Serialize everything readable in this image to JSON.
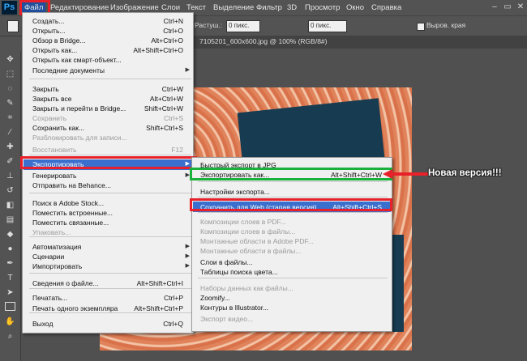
{
  "app": {
    "logo": "Ps"
  },
  "menubar": [
    "Файл",
    "Редактирование",
    "Изображение",
    "Слои",
    "Текст",
    "Выделение",
    "Фильтр",
    "3D",
    "Просмотр",
    "Окно",
    "Справка"
  ],
  "options": {
    "feather_label": "Растуш.:",
    "feather_value": "0 пикс.",
    "width_value": "0 пикс.",
    "antialias_label": "Выров. края"
  },
  "document_tab": {
    "title": "7105201_600x600.jpg @ 100% (RGB/8#)"
  },
  "file_menu": {
    "items": [
      {
        "label": "Создать...",
        "shortcut": "Ctrl+N",
        "disabled": false
      },
      {
        "label": "Открыть...",
        "shortcut": "Ctrl+O",
        "disabled": false
      },
      {
        "label": "Обзор в Bridge...",
        "shortcut": "Alt+Ctrl+O",
        "disabled": false
      },
      {
        "label": "Открыть как...",
        "shortcut": "Alt+Shift+Ctrl+O",
        "disabled": false
      },
      {
        "label": "Открыть как смарт-объект...",
        "shortcut": "",
        "disabled": false
      },
      {
        "label": "Последние документы",
        "shortcut": "",
        "disabled": false
      },
      {
        "label": "Закрыть",
        "shortcut": "Ctrl+W",
        "disabled": false
      },
      {
        "label": "Закрыть все",
        "shortcut": "Alt+Ctrl+W",
        "disabled": false
      },
      {
        "label": "Закрыть и перейти в Bridge...",
        "shortcut": "Shift+Ctrl+W",
        "disabled": false
      },
      {
        "label": "Сохранить",
        "shortcut": "Ctrl+S",
        "disabled": true
      },
      {
        "label": "Сохранить как...",
        "shortcut": "Shift+Ctrl+S",
        "disabled": false
      },
      {
        "label": "Разблокировать для записи...",
        "shortcut": "",
        "disabled": true
      },
      {
        "label": "Восстановить",
        "shortcut": "F12",
        "disabled": true
      },
      {
        "label": "Экспортировать",
        "shortcut": "",
        "disabled": false
      },
      {
        "label": "Генерировать",
        "shortcut": "",
        "disabled": false
      },
      {
        "label": "Отправить на Behance...",
        "shortcut": "",
        "disabled": false
      },
      {
        "label": "Поиск в Adobe Stock...",
        "shortcut": "",
        "disabled": false
      },
      {
        "label": "Поместить встроенные...",
        "shortcut": "",
        "disabled": false
      },
      {
        "label": "Поместить связанные...",
        "shortcut": "",
        "disabled": false
      },
      {
        "label": "Упаковать...",
        "shortcut": "",
        "disabled": true
      },
      {
        "label": "Автоматизация",
        "shortcut": "",
        "disabled": false
      },
      {
        "label": "Сценарии",
        "shortcut": "",
        "disabled": false
      },
      {
        "label": "Импортировать",
        "shortcut": "",
        "disabled": false
      },
      {
        "label": "Сведения о файле...",
        "shortcut": "Alt+Shift+Ctrl+I",
        "disabled": false
      },
      {
        "label": "Печатать...",
        "shortcut": "Ctrl+P",
        "disabled": false
      },
      {
        "label": "Печать одного экземпляра",
        "shortcut": "Alt+Shift+Ctrl+P",
        "disabled": false
      },
      {
        "label": "Выход",
        "shortcut": "Ctrl+Q",
        "disabled": false
      }
    ]
  },
  "export_menu": {
    "items": [
      {
        "label": "Быстрый экспорт в JPG",
        "shortcut": "",
        "disabled": false
      },
      {
        "label": "Экспортировать как...",
        "shortcut": "Alt+Shift+Ctrl+W",
        "disabled": false
      },
      {
        "label": "Настройки экспорта...",
        "shortcut": "",
        "disabled": false
      },
      {
        "label": "Сохранить для Web (старая версия)...",
        "shortcut": "Alt+Shift+Ctrl+S",
        "disabled": false
      },
      {
        "label": "Композиции слоев в PDF...",
        "shortcut": "",
        "disabled": true
      },
      {
        "label": "Композиции слоев в файлы...",
        "shortcut": "",
        "disabled": true
      },
      {
        "label": "Монтажные области в Adobe PDF...",
        "shortcut": "",
        "disabled": true
      },
      {
        "label": "Монтажные области в файлы...",
        "shortcut": "",
        "disabled": true
      },
      {
        "label": "Слои в файлы...",
        "shortcut": "",
        "disabled": false
      },
      {
        "label": "Таблицы поиска цвета...",
        "shortcut": "",
        "disabled": false
      },
      {
        "label": "Наборы данных как файлы...",
        "shortcut": "",
        "disabled": true
      },
      {
        "label": "Zoomify...",
        "shortcut": "",
        "disabled": false
      },
      {
        "label": "Контуры в Illustrator...",
        "shortcut": "",
        "disabled": false
      },
      {
        "label": "Экспорт видео...",
        "shortcut": "",
        "disabled": true
      }
    ]
  },
  "annotation": {
    "text": "Новая версия!!!"
  },
  "colors": {
    "highlight": "#3b6fce",
    "red_frame": "#e8202a",
    "green_frame": "#19b13c"
  }
}
